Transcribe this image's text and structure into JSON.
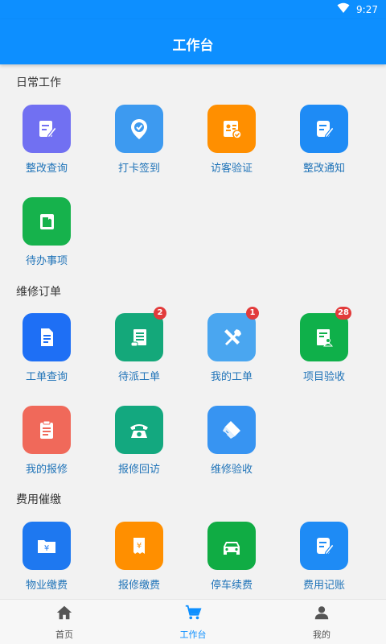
{
  "status_bar": {
    "time": "9:27",
    "wifi_icon": "wifi-icon"
  },
  "app_bar": {
    "title": "工作台"
  },
  "sections": {
    "daily": {
      "title": "日常工作",
      "items": [
        {
          "label": "整改查询",
          "icon": "edit-note-icon",
          "color": "#7170f2"
        },
        {
          "label": "打卡签到",
          "icon": "location-check-icon",
          "color": "#3d9af0"
        },
        {
          "label": "访客验证",
          "icon": "visitor-id-icon",
          "color": "#ff8f00"
        },
        {
          "label": "整改通知",
          "icon": "edit-doc-icon",
          "color": "#1e8bf5"
        },
        {
          "label": "待办事项",
          "icon": "todo-book-icon",
          "color": "#16b24c"
        }
      ]
    },
    "repair": {
      "title": "维修订单",
      "items": [
        {
          "label": "工单查询",
          "icon": "document-icon",
          "color": "#1e6ff5",
          "badge": ""
        },
        {
          "label": "待派工单",
          "icon": "scroll-list-icon",
          "color": "#14a87a",
          "badge": "2"
        },
        {
          "label": "我的工单",
          "icon": "tools-icon",
          "color": "#4aa6f0",
          "badge": "1"
        },
        {
          "label": "项目验收",
          "icon": "user-doc-icon",
          "color": "#0fb04a",
          "badge": "28"
        },
        {
          "label": "我的报修",
          "icon": "clipboard-icon",
          "color": "#f0695a",
          "badge": ""
        },
        {
          "label": "报修回访",
          "icon": "telephone-icon",
          "color": "#13a87f",
          "badge": ""
        },
        {
          "label": "维修验收",
          "icon": "brush-icon",
          "color": "#3794f2",
          "badge": ""
        }
      ]
    },
    "fees": {
      "title": "费用催缴",
      "items": [
        {
          "label": "物业缴费",
          "icon": "yuan-folder-icon",
          "color": "#1e78f0"
        },
        {
          "label": "报修缴费",
          "icon": "yuan-receipt-icon",
          "color": "#ff8f00"
        },
        {
          "label": "停车续费",
          "icon": "car-icon",
          "color": "#10ac44"
        },
        {
          "label": "费用记账",
          "icon": "edit-doc-icon",
          "color": "#1e8bf5"
        }
      ]
    }
  },
  "bottom_nav": {
    "items": [
      {
        "label": "首页",
        "icon": "home-icon"
      },
      {
        "label": "工作台",
        "icon": "cart-icon",
        "active": true
      },
      {
        "label": "我的",
        "icon": "person-icon"
      }
    ],
    "active_color": "#0d8fff"
  }
}
